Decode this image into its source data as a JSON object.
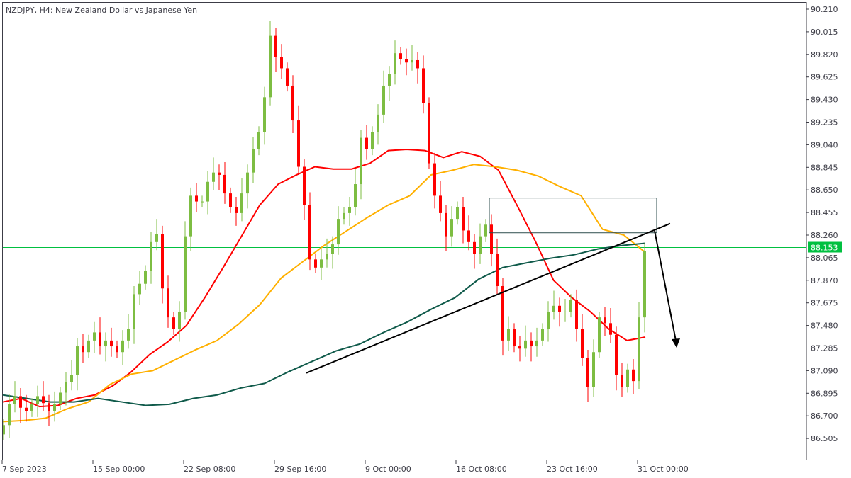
{
  "header": {
    "title": "NZDJPY, H4:  New Zealand Dollar vs Japanese Yen"
  },
  "colors": {
    "bull": "#7dbd42",
    "bear": "#ff0000",
    "ma_fast": "#ff0000",
    "ma_mid": "#ffb000",
    "ma_slow": "#0f5a4a",
    "price_line": "#00c040",
    "drawing": "#000000",
    "zone": "#2f4f4f"
  },
  "chart_data": {
    "type": "candlestick",
    "symbol": "NZDJPY",
    "timeframe": "H4",
    "title": "NZDJPY, H4:  New Zealand Dollar vs Japanese Yen",
    "ylim": [
      86.35,
      90.28
    ],
    "y_ticks": [
      "90.210",
      "90.015",
      "89.820",
      "89.625",
      "89.430",
      "89.235",
      "89.040",
      "88.845",
      "88.650",
      "88.455",
      "88.260",
      "88.065",
      "87.870",
      "87.675",
      "87.480",
      "87.285",
      "87.090",
      "86.895",
      "86.700",
      "86.505"
    ],
    "x_ticks": [
      "7 Sep 2023",
      "15 Sep 00:00",
      "22 Sep 08:00",
      "29 Sep 16:00",
      "9 Oct 00:00",
      "16 Oct 08:00",
      "23 Oct 16:00",
      "31 Oct 00:00"
    ],
    "current_price": "88.153",
    "closes": [
      86.62,
      86.8,
      86.87,
      86.77,
      86.74,
      86.8,
      86.87,
      86.81,
      86.74,
      86.8,
      86.9,
      86.99,
      87.05,
      87.3,
      87.25,
      87.35,
      87.42,
      87.3,
      87.35,
      87.3,
      87.25,
      87.35,
      87.45,
      87.75,
      87.84,
      87.95,
      88.2,
      88.27,
      87.8,
      87.55,
      87.45,
      87.6,
      88.25,
      88.6,
      88.55,
      88.55,
      88.72,
      88.8,
      88.78,
      88.62,
      88.5,
      88.45,
      88.62,
      88.8,
      89.0,
      89.15,
      89.45,
      89.98,
      89.8,
      89.7,
      89.55,
      89.25,
      88.85,
      88.52,
      88.05,
      87.98,
      88.05,
      88.1,
      88.18,
      88.4,
      88.45,
      88.5,
      88.7,
      89.1,
      89.0,
      89.15,
      89.3,
      89.55,
      89.65,
      89.83,
      89.78,
      89.75,
      89.77,
      89.7,
      89.4,
      88.88,
      88.6,
      88.45,
      88.25,
      88.4,
      88.5,
      88.3,
      88.2,
      88.1,
      88.25,
      88.35,
      88.1,
      87.82,
      87.35,
      87.45,
      87.3,
      87.28,
      87.35,
      87.3,
      87.35,
      87.45,
      87.6,
      87.65,
      87.6,
      87.6,
      87.7,
      87.45,
      87.2,
      86.95,
      87.25,
      87.55,
      87.5,
      87.4,
      87.05,
      86.95,
      87.1,
      87.0,
      87.55,
      88.12
    ],
    "moving_averages": [
      {
        "color": "#ff0000",
        "values": [
          86.82,
          86.85,
          86.78,
          86.79,
          86.85,
          86.88,
          86.96,
          87.08,
          87.23,
          87.34,
          87.48,
          87.72,
          87.98,
          88.25,
          88.52,
          88.7,
          88.78,
          88.85,
          88.83,
          88.83,
          88.88,
          88.99,
          89.0,
          88.99,
          88.93,
          88.98,
          88.94,
          88.82,
          88.52,
          88.21,
          87.87,
          87.72,
          87.6,
          87.45,
          87.35,
          87.38
        ]
      },
      {
        "color": "#ffb000",
        "values": [
          86.65,
          86.66,
          86.68,
          86.76,
          86.82,
          86.97,
          87.06,
          87.09,
          87.18,
          87.27,
          87.35,
          87.49,
          87.66,
          87.89,
          88.03,
          88.17,
          88.29,
          88.41,
          88.52,
          88.6,
          88.78,
          88.82,
          88.87,
          88.85,
          88.82,
          88.77,
          88.68,
          88.6,
          88.31,
          88.26,
          88.11
        ]
      },
      {
        "color": "#0f5a4a",
        "values": [
          86.88,
          86.85,
          86.82,
          86.82,
          86.85,
          86.82,
          86.79,
          86.8,
          86.85,
          86.88,
          86.94,
          86.98,
          87.08,
          87.17,
          87.26,
          87.32,
          87.42,
          87.51,
          87.62,
          87.72,
          87.88,
          87.98,
          88.02,
          88.06,
          88.09,
          88.14,
          88.17,
          88.19
        ]
      }
    ],
    "drawings": {
      "trendline_prices": [
        87.07,
        88.36
      ],
      "zone_prices": [
        88.58,
        88.28
      ],
      "arrow_prices": [
        88.3,
        87.3
      ]
    },
    "grid": false
  }
}
